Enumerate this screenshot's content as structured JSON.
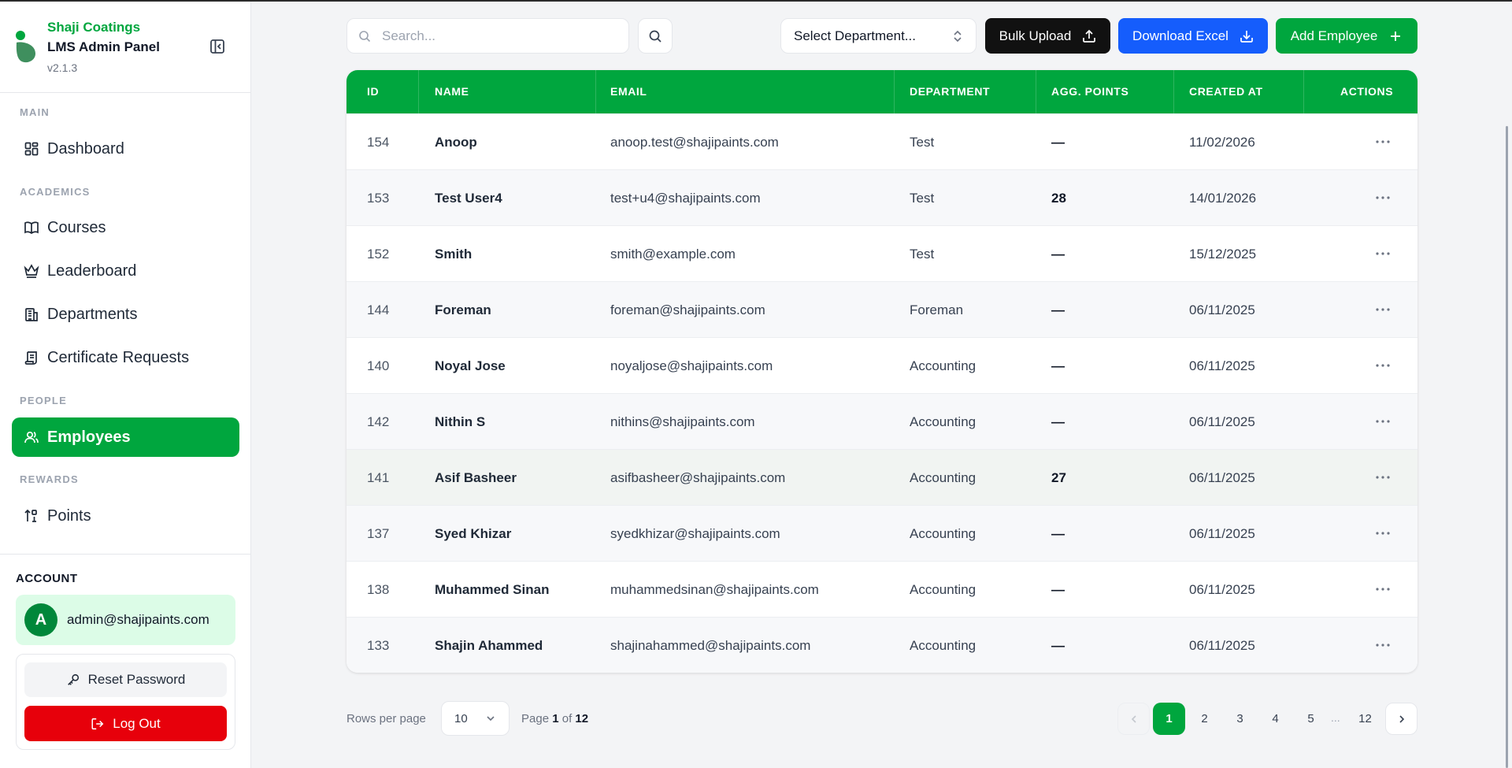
{
  "sidebar": {
    "brand_name": "Shaji Coatings",
    "brand_sub": "LMS Admin Panel",
    "version": "v2.1.3",
    "sections": {
      "main": "MAIN",
      "academics": "ACADEMICS",
      "people": "PEOPLE",
      "rewards": "REWARDS"
    },
    "items": [
      {
        "label": "Dashboard",
        "icon": "dashboard-icon"
      },
      {
        "label": "Courses",
        "icon": "book-icon"
      },
      {
        "label": "Leaderboard",
        "icon": "crown-icon"
      },
      {
        "label": "Departments",
        "icon": "building-icon"
      },
      {
        "label": "Certificate Requests",
        "icon": "scroll-icon"
      },
      {
        "label": "Employees",
        "icon": "users-icon",
        "active": true
      },
      {
        "label": "Points",
        "icon": "points-icon"
      }
    ],
    "account": {
      "label": "ACCOUNT",
      "avatar_letter": "A",
      "email": "admin@shajipaints.com",
      "reset_label": "Reset Password",
      "logout_label": "Log Out"
    }
  },
  "toolbar": {
    "search_placeholder": "Search...",
    "department_select": "Select Department...",
    "bulk_upload": "Bulk Upload",
    "download_excel": "Download Excel",
    "add_employee": "Add Employee"
  },
  "table": {
    "headers": [
      "ID",
      "NAME",
      "EMAIL",
      "DEPARTMENT",
      "AGG. POINTS",
      "CREATED AT",
      "ACTIONS"
    ],
    "rows": [
      {
        "id": "154",
        "name": "Anoop",
        "email": "anoop.test@shajipaints.com",
        "department": "Test",
        "points": "—",
        "created": "11/02/2026"
      },
      {
        "id": "153",
        "name": "Test User4",
        "email": "test+u4@shajipaints.com",
        "department": "Test",
        "points": "28",
        "created": "14/01/2026"
      },
      {
        "id": "152",
        "name": "Smith",
        "email": "smith@example.com",
        "department": "Test",
        "points": "—",
        "created": "15/12/2025"
      },
      {
        "id": "144",
        "name": "Foreman",
        "email": "foreman@shajipaints.com",
        "department": "Foreman",
        "points": "—",
        "created": "06/11/2025"
      },
      {
        "id": "140",
        "name": "Noyal Jose",
        "email": "noyaljose@shajipaints.com",
        "department": "Accounting",
        "points": "—",
        "created": "06/11/2025"
      },
      {
        "id": "142",
        "name": "Nithin S",
        "email": "nithins@shajipaints.com",
        "department": "Accounting",
        "points": "—",
        "created": "06/11/2025"
      },
      {
        "id": "141",
        "name": "Asif Basheer",
        "email": "asifbasheer@shajipaints.com",
        "department": "Accounting",
        "points": "27",
        "created": "06/11/2025"
      },
      {
        "id": "137",
        "name": "Syed Khizar",
        "email": "syedkhizar@shajipaints.com",
        "department": "Accounting",
        "points": "—",
        "created": "06/11/2025"
      },
      {
        "id": "138",
        "name": "Muhammed Sinan",
        "email": "muhammedsinan@shajipaints.com",
        "department": "Accounting",
        "points": "—",
        "created": "06/11/2025"
      },
      {
        "id": "133",
        "name": "Shajin Ahammed",
        "email": "shajinahammed@shajipaints.com",
        "department": "Accounting",
        "points": "—",
        "created": "06/11/2025"
      }
    ]
  },
  "pagination": {
    "rows_per_page_label": "Rows per page",
    "rows_per_page": "10",
    "page_word": "Page",
    "current_page": "1",
    "of_word": "of",
    "total_pages": "12",
    "pages": [
      "1",
      "2",
      "3",
      "4",
      "5"
    ],
    "ellipsis": "...",
    "last_page": "12"
  },
  "colors": {
    "brand_green": "#00a63e",
    "excel_blue": "#155dfc",
    "logout_red": "#e7000b",
    "bulk_black": "#111111"
  }
}
